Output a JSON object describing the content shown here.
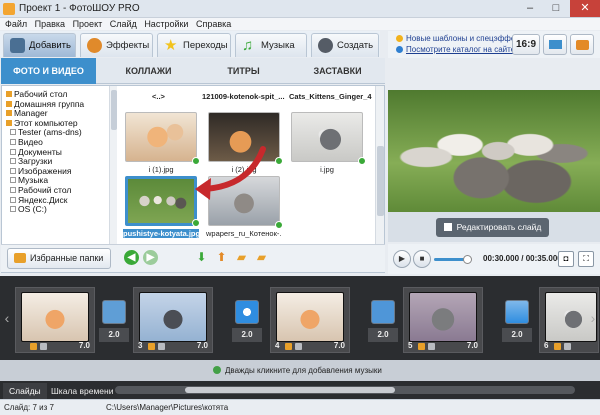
{
  "window": {
    "title": "Проект 1 - ФотоШОУ PRO",
    "min": "–",
    "max": "□",
    "close": "✕"
  },
  "menu": [
    "Файл",
    "Правка",
    "Проект",
    "Слайд",
    "Настройки",
    "Справка"
  ],
  "main_tabs": [
    {
      "label": "Добавить",
      "icon": "camera-icon",
      "color": "#4a6f93"
    },
    {
      "label": "Эффекты",
      "icon": "palette-icon",
      "color": "#e08a2b"
    },
    {
      "label": "Переходы",
      "icon": "star-icon",
      "color": "#f2c31d"
    },
    {
      "label": "Музыка",
      "icon": "music-note-icon",
      "color": "#3aa938"
    },
    {
      "label": "Создать",
      "icon": "film-reel-icon",
      "color": "#555c66"
    }
  ],
  "topright": {
    "line1": "Новые шаблоны и спецэффекты",
    "line2": "Посмотрите каталог на сайте...",
    "aspect_btn": "16:9"
  },
  "sub_tabs": [
    "ФОТО И ВИДЕО",
    "КОЛЛАЖИ",
    "ТИТРЫ",
    "ЗАСТАВКИ"
  ],
  "tree": [
    {
      "label": "Рабочий стол",
      "indent": 0
    },
    {
      "label": "Домашняя группа",
      "indent": 0
    },
    {
      "label": "Manager",
      "indent": 0
    },
    {
      "label": "Этот компьютер",
      "indent": 0
    },
    {
      "label": "Tester (ams-dns)",
      "indent": 1
    },
    {
      "label": "Видео",
      "indent": 1
    },
    {
      "label": "Документы",
      "indent": 1
    },
    {
      "label": "Загрузки",
      "indent": 1
    },
    {
      "label": "Изображения",
      "indent": 1
    },
    {
      "label": "Музыка",
      "indent": 1
    },
    {
      "label": "Рабочий стол",
      "indent": 1
    },
    {
      "label": "Яндекс.Диск",
      "indent": 1
    },
    {
      "label": "OS (C:)",
      "indent": 1
    }
  ],
  "top_names": [
    "<..>",
    "121009-kotenok-spit_...",
    "Cats_Kittens_Ginger_4..."
  ],
  "files": [
    {
      "name": "i (1).jpg"
    },
    {
      "name": "i (2).jpg"
    },
    {
      "name": "i.jpg"
    },
    {
      "name": "pushistye-kotyata.jpg"
    },
    {
      "name": "wpapers_ru_Котенок-..."
    }
  ],
  "favorites_button": "Избранные папки",
  "edit_slide_button": "Редактировать слайд",
  "player": {
    "time": "00:30.000 / 00:35.000"
  },
  "timeline": {
    "slides": [
      {
        "num": "",
        "duration": "7.0"
      },
      {
        "num": "3",
        "duration": "7.0"
      },
      {
        "num": "4",
        "duration": "7.0"
      },
      {
        "num": "5",
        "duration": "7.0"
      },
      {
        "num": "6",
        "duration": ""
      }
    ],
    "transitions": [
      {
        "duration": "2.0"
      },
      {
        "duration": "2.0"
      },
      {
        "duration": "2.0"
      },
      {
        "duration": "2.0"
      }
    ]
  },
  "music_hint": "Дважды кликните для добавления музыки",
  "view_tabs": [
    "Слайды",
    "Шкала времени"
  ],
  "status": {
    "slide": "Слайд: 7 из 7",
    "path": "C:\\Users\\Manager\\Pictures\\котята"
  }
}
